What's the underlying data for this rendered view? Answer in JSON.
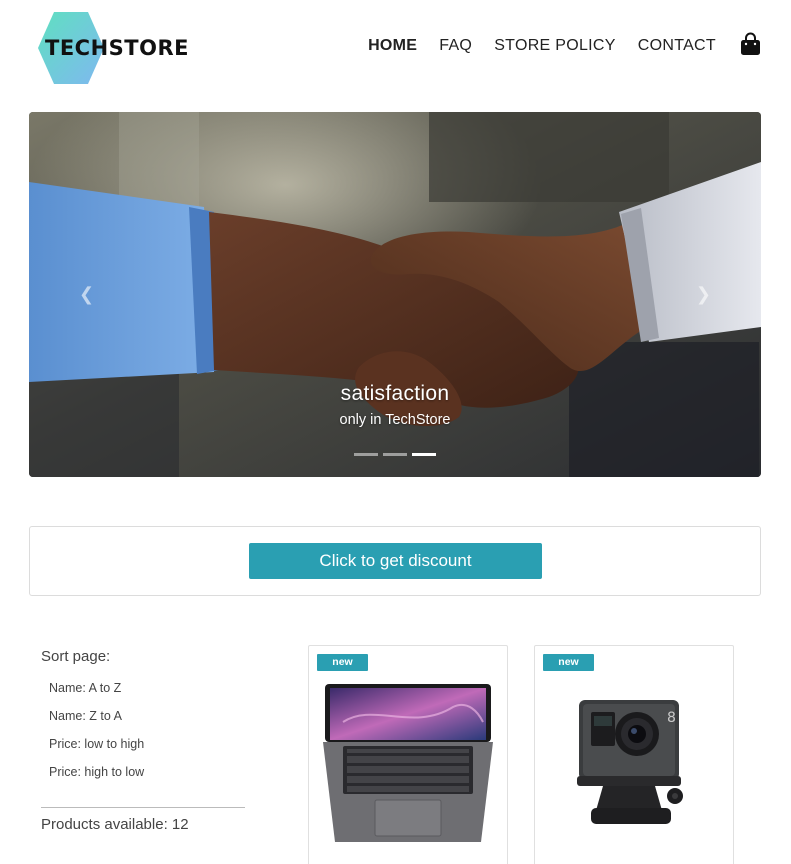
{
  "brand": {
    "name": "TECHSTORE"
  },
  "nav": {
    "items": [
      "HOME",
      "FAQ",
      "STORE POLICY",
      "CONTACT"
    ],
    "active": "HOME",
    "cart_icon": "shopping-bag-icon"
  },
  "hero": {
    "title": "satisfaction",
    "subtitle": "only in TechStore",
    "prev_icon": "chevron-left-icon",
    "next_icon": "chevron-right-icon",
    "slides_count": 3,
    "active_slide": 3
  },
  "discount": {
    "button_label": "Click to get discount"
  },
  "sort": {
    "title": "Sort page:",
    "options": [
      "Name: A to Z",
      "Name: Z to A",
      "Price: low to high",
      "Price: high to low"
    ],
    "products_label": "Products available: 12"
  },
  "products": [
    {
      "badge": "new",
      "image": "laptop"
    },
    {
      "badge": "new",
      "image": "action-camera"
    }
  ],
  "colors": {
    "accent": "#2a9fb2",
    "logo_hex": "#4fd6c8"
  }
}
